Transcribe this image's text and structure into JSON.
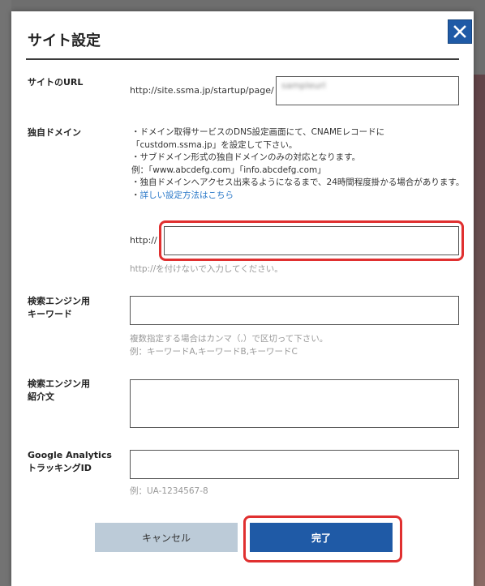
{
  "dialog": {
    "title": "サイト設定",
    "close_label": "close"
  },
  "url_field": {
    "label": "サイトのURL",
    "prefix": "http://site.ssma.jp/startup/page/",
    "value": "sampleurl"
  },
  "domain": {
    "label": "独自ドメイン",
    "bullets": [
      "・ドメイン取得サービスのDNS設定画面にて、CNAMEレコードに",
      "「custdom.ssma.jp」を設定して下さい。",
      "・サブドメイン形式の独自ドメインのみの対応となります。",
      "例：「www.abcdefg.com」「info.abcdefg.com」",
      "・独自ドメインへアクセス出来るようになるまで、24時間程度掛かる場合があります。"
    ],
    "link_prefix": "・",
    "link_text": "詳しい設定方法はこちら",
    "input_prefix": "http://",
    "input_value": "",
    "hint": "http://を付けないで入力してください。"
  },
  "keywords": {
    "label_line1": "検索エンジン用",
    "label_line2": "キーワード",
    "value": "",
    "hint_line1": "複数指定する場合はカンマ（,）で区切って下さい。",
    "hint_line2": "例：キーワードA,キーワードB,キーワードC"
  },
  "description": {
    "label_line1": "検索エンジン用",
    "label_line2": "紹介文",
    "value": ""
  },
  "analytics": {
    "label_line1": "Google Analytics",
    "label_line2": "トラッキングID",
    "value": "",
    "hint": "例：UA-1234567-8"
  },
  "buttons": {
    "cancel": "キャンセル",
    "done": "完了"
  },
  "colors": {
    "accent": "#1f5aa6",
    "highlight": "#e03030",
    "cancel_bg": "#bccbd8"
  }
}
